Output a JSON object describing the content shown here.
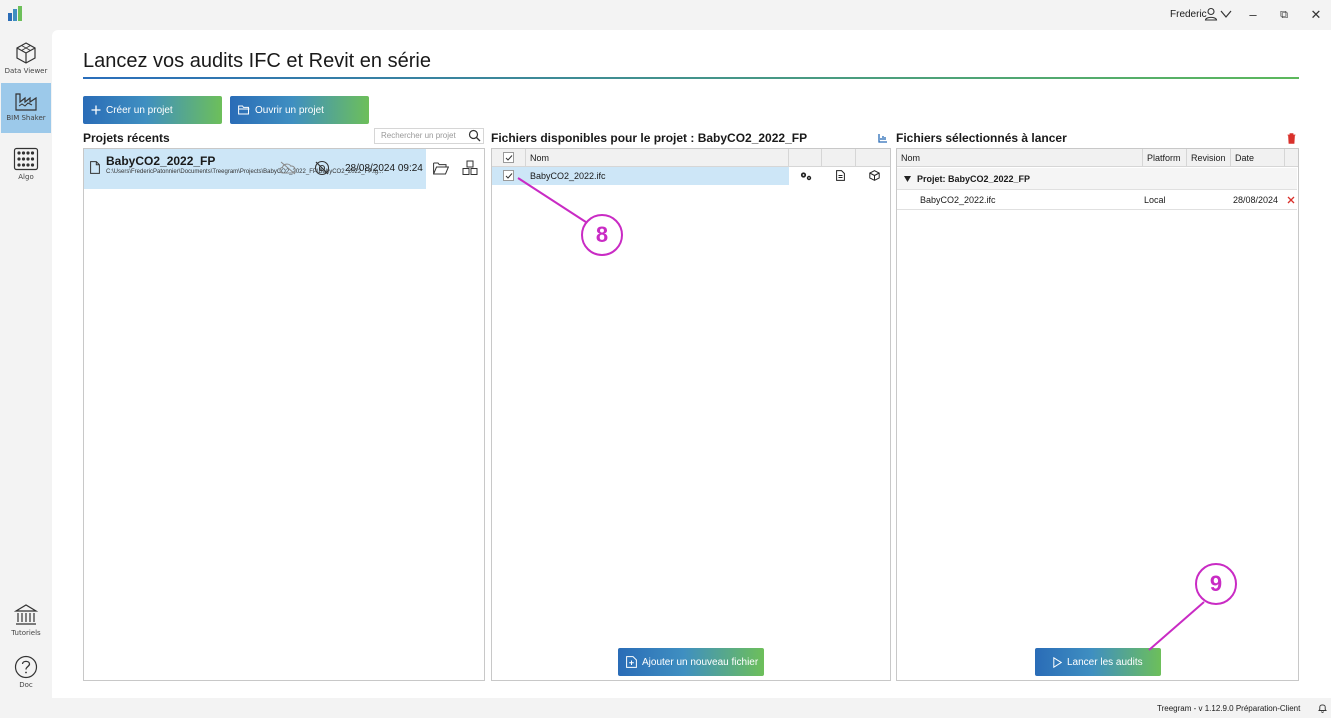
{
  "window": {
    "user_name": "Frederic",
    "minimize": "–",
    "restore": "⧉",
    "close": "✕"
  },
  "sidebar": {
    "items": [
      {
        "label": "Data Viewer",
        "icon": "cube-icon"
      },
      {
        "label": "BIM Shaker",
        "icon": "factory-icon"
      },
      {
        "label": "Algo",
        "icon": "grid-nodes-icon"
      },
      {
        "label": "Tutoriels",
        "icon": "institution-icon"
      },
      {
        "label": "Doc",
        "icon": "help-icon"
      }
    ],
    "active_index": 1
  },
  "main": {
    "title": "Lancez vos audits IFC et Revit en série",
    "create_button": "Créer un projet",
    "open_button": "Ouvrir un projet"
  },
  "recent": {
    "title": "Projets récents",
    "search_placeholder": "Rechercher un projet",
    "project": {
      "name": "BabyCO2_2022_FP",
      "path": "C:\\Users\\FredericPatonnier\\Documents\\Treegram\\Projects\\BabyCO2_2022_FP\\BabyCO2_2022_FP.tg...",
      "date": "28/08/2024 09:24"
    }
  },
  "available": {
    "title": "Fichiers disponibles pour le projet : BabyCO2_2022_FP",
    "col_name": "Nom",
    "files": [
      {
        "name": "BabyCO2_2022.ifc"
      }
    ],
    "add_button": "Ajouter un nouveau fichier"
  },
  "selected": {
    "title": "Fichiers sélectionnés à lancer",
    "columns": [
      "Nom",
      "Platform",
      "Revision",
      "Date"
    ],
    "group_label": "Projet: BabyCO2_2022_FP",
    "rows": [
      {
        "name": "BabyCO2_2022.ifc",
        "platform": "Local",
        "revision": "",
        "date": "28/08/2024"
      }
    ],
    "launch_button": "Lancer les audits"
  },
  "annotations": [
    "8",
    "9"
  ],
  "status": {
    "version": "Treegram - v 1.12.9.0 Préparation-Client"
  },
  "colors": {
    "accent_blue": "#2a6cb7",
    "accent_green": "#6dbf5a",
    "selection": "#cde6f7",
    "annotation": "#c92bc4",
    "delete_red": "#d9312b"
  }
}
